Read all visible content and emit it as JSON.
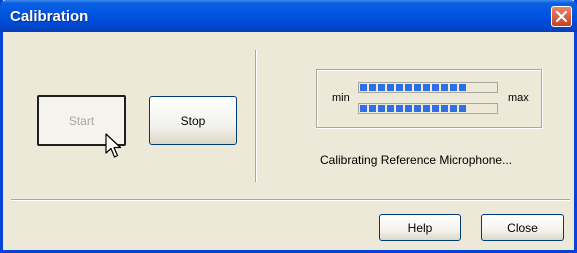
{
  "window": {
    "title": "Calibration"
  },
  "buttons": {
    "start": "Start",
    "stop": "Stop",
    "help": "Help",
    "close": "Close"
  },
  "meter": {
    "min_label": "min",
    "max_label": "max",
    "bars": [
      {
        "level": 0.78
      },
      {
        "level": 0.78
      }
    ]
  },
  "status": "Calibrating Reference Microphone...",
  "icons": {
    "close": "close-icon",
    "cursor": "mouse-pointer-icon"
  },
  "colors": {
    "titlebar": "#0054e3",
    "meter_fill": "#2e6ee6",
    "close_button": "#c7401f"
  }
}
